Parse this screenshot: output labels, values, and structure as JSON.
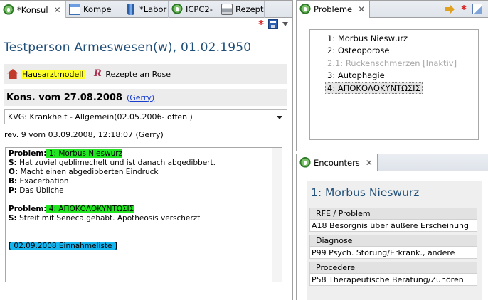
{
  "editor": {
    "tabs": [
      {
        "label": "*Konsul",
        "icon": "tree-icon"
      },
      {
        "label": "Kompe",
        "icon": "window-icon"
      },
      {
        "label": "*Labor",
        "icon": "flask-icon"
      },
      {
        "label": "ICPC2-",
        "icon": "tree-icon"
      },
      {
        "label": "Rezept",
        "icon": "printer-icon"
      }
    ],
    "patient_title": "Testperson Armeswesen(w), 01.02.1950",
    "chips": {
      "hausarzt": "Hausarztmodell",
      "rezepte": "Rezepte an Rose"
    },
    "kons_title": "Kons. vom 27.08.2008",
    "kons_author": "(Gerry)",
    "fall_select": "KVG: Krankheit - Allgemein(02.05.2006- offen )",
    "revision": "rev. 9 vom 03.09.2008, 12:18:07 (Gerry)",
    "text": {
      "p1_label": "Problem:",
      "p1_value": " 1: Morbus Nieswurz",
      "s1_label": "S:",
      "s1_value": " Hat zuviel geblimechelt und ist danach abgedibbert.",
      "o1_label": "O:",
      "o1_value": " Macht einen abgedibberten Eindruck",
      "b1_label": "B:",
      "b1_value": " Exacerbation",
      "pp1_label": "P:",
      "pp1_value": " Das Übliche",
      "p2_label": "Problem:",
      "p2_value": " 4: ΑΠΟΚΟΛΟΚΥΝΤΩΣΙΣ",
      "s2_label": "S:",
      "s2_value": " Streit mit Seneca gehabt. Apotheosis verscherzt",
      "einnahme": "[ 02.09.2008 Einnahmeliste ]"
    }
  },
  "probleme": {
    "tab_label": "Probleme",
    "items": [
      {
        "label": "1: Morbus Nieswurz",
        "state": "normal"
      },
      {
        "label": "2: Osteoporose",
        "state": "normal"
      },
      {
        "label": "2.1: Rückenschmerzen [Inaktiv]",
        "state": "inactive"
      },
      {
        "label": "3: Autophagie",
        "state": "normal"
      },
      {
        "label": "4: ΑΠΟΚΟΛΟΚΥΝΤΩΣΙΣ",
        "state": "selected"
      }
    ]
  },
  "encounters": {
    "tab_label": "Encounters",
    "title": "1: Morbus Nieswurz",
    "groups": [
      {
        "header": "RFE / Problem",
        "value": "A18 Besorgnis über äußere Erscheinung"
      },
      {
        "header": "Diagnose",
        "value": "P99 Psych. Störung/Erkrank., andere"
      },
      {
        "header": "Procedere",
        "value": "P58 Therapeutische Beratung/Zuhören"
      }
    ]
  },
  "colors": {
    "title_blue": "#1f4e78",
    "highlight_green": "#22e622",
    "highlight_cyan": "#14b4ee",
    "highlight_yellow": "#ffff2a",
    "dirty_star": "#d81e1e"
  }
}
